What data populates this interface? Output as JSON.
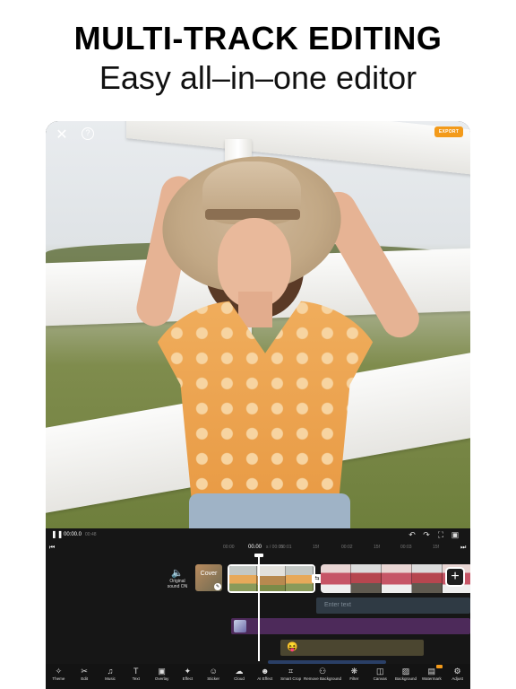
{
  "headline": "MULTI-TRACK EDITING",
  "subline": "Easy all–in–one editor",
  "preview": {
    "close_icon": "close-icon",
    "help_icon": "help-icon",
    "export_label": "EXPORT",
    "accent_color": "#f39a1a"
  },
  "controls": {
    "current_time": "00:00.0",
    "total_time": "00:48"
  },
  "ruler": {
    "start": "00:00",
    "current": "00.00",
    "sep": "s / 00:05",
    "mid": "00:01",
    "tick1": "15f",
    "t2": "00:02",
    "tick2": "15f",
    "t3": "00:03",
    "tick3": "15f"
  },
  "tracks": {
    "original_sound_line1": "Original",
    "original_sound_line2": "sound ON",
    "cover_label": "Cover",
    "text_placeholder": "Enter text",
    "sticker_emoji": "😝"
  },
  "toolbar": {
    "items": [
      {
        "label": "Theme",
        "icon": "theme-icon"
      },
      {
        "label": "Edit",
        "icon": "scissors-icon"
      },
      {
        "label": "Music",
        "icon": "music-icon"
      },
      {
        "label": "Text",
        "icon": "text-icon"
      },
      {
        "label": "Overlay",
        "icon": "overlay-icon"
      },
      {
        "label": "Effect",
        "icon": "effect-icon"
      },
      {
        "label": "Sticker",
        "icon": "sticker-icon"
      },
      {
        "label": "Cloud",
        "icon": "cloud-icon"
      },
      {
        "label": "AI Effect",
        "icon": "ai-effect-icon"
      },
      {
        "label": "Smart Crop",
        "icon": "smart-crop-icon"
      },
      {
        "label": "Remove Background",
        "icon": "remove-background-icon"
      },
      {
        "label": "Filter",
        "icon": "filter-icon"
      },
      {
        "label": "Canvas",
        "icon": "canvas-icon"
      },
      {
        "label": "Background",
        "icon": "background-icon"
      },
      {
        "label": "Watermark",
        "icon": "watermark-icon"
      },
      {
        "label": "Adjust",
        "icon": "adjust-icon"
      }
    ]
  }
}
